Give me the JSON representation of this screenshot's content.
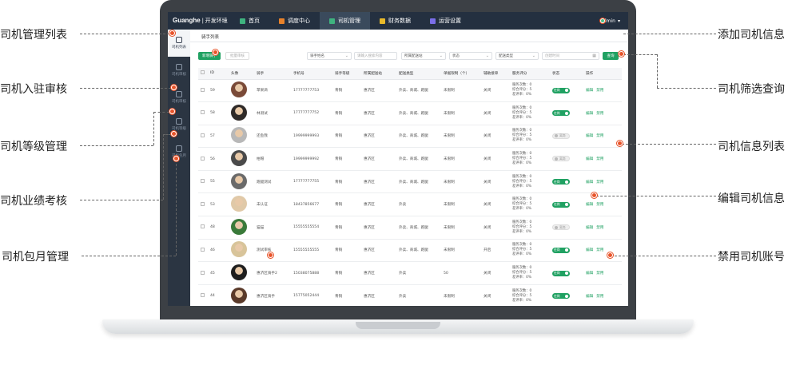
{
  "app": {
    "logo": "Guanghe",
    "logo_sub": "| 开发环境",
    "nav": [
      {
        "label": "首页",
        "icon": "home-icon",
        "color": "#3fb37f"
      },
      {
        "label": "调度中心",
        "icon": "dispatch-icon",
        "color": "#e8822a"
      },
      {
        "label": "司机管理",
        "icon": "driver-icon",
        "color": "#3fb37f"
      },
      {
        "label": "财务数据",
        "icon": "finance-icon",
        "color": "#e8b92a"
      },
      {
        "label": "运营设置",
        "icon": "settings-icon",
        "color": "#7a6ee8"
      }
    ],
    "admin": "admin"
  },
  "sidebar": [
    {
      "label": "司机列表"
    },
    {
      "label": "司机审核"
    },
    {
      "label": "司机审核"
    },
    {
      "label": "司机等级"
    },
    {
      "label": "司机包月"
    }
  ],
  "breadcrumb": "骑手列表",
  "toolbar": {
    "add": "新增骑手",
    "batch": "批量审核"
  },
  "filters": {
    "name": "骑手姓名",
    "search_placeholder": "请输入搜索内容",
    "station": "所属配送站",
    "status": "状态",
    "type": "配送类型",
    "time": "创建时间",
    "search_button": "查询"
  },
  "table": {
    "headers": [
      "",
      "ID",
      "头像",
      "骑手",
      "手机号",
      "骑手等级",
      "所属配送站",
      "配送类型",
      "单据限制（个）",
      "辅助接单",
      "服务评分",
      "状态",
      "操作"
    ],
    "rows": [
      {
        "id": "59",
        "name": "苹果滴",
        "phone": "17777777753",
        "level": "青铜",
        "station": "惠济区",
        "type": "外卖、商城、跑腿",
        "limit": "未限制",
        "assist": "关闭",
        "status": "on",
        "status_label": "在岗"
      },
      {
        "id": "58",
        "name": "林测试",
        "phone": "17777777752",
        "level": "青铜",
        "station": "惠济区",
        "type": "外卖、商城、跑腿",
        "limit": "未限制",
        "assist": "关闭",
        "status": "on",
        "status_label": "在岗"
      },
      {
        "id": "57",
        "name": "还鱼我",
        "phone": "19999999993",
        "level": "青铜",
        "station": "惠济区",
        "type": "外卖、商城、跑腿",
        "limit": "未限制",
        "assist": "关闭",
        "status": "off",
        "status_label": "离岗"
      },
      {
        "id": "56",
        "name": "柏帽",
        "phone": "19999999992",
        "level": "青铜",
        "station": "惠济区",
        "type": "外卖、商城、跑腿",
        "limit": "未限制",
        "assist": "关闭",
        "status": "off",
        "status_label": "离岗"
      },
      {
        "id": "55",
        "name": "跑腿测试",
        "phone": "17777777755",
        "level": "青铜",
        "station": "惠济区",
        "type": "外卖、商城、跑腿",
        "limit": "未限制",
        "assist": "关闭",
        "status": "on",
        "status_label": "在岗"
      },
      {
        "id": "53",
        "name": "未认证",
        "phone": "18437856677",
        "level": "青铜",
        "station": "惠济区",
        "type": "外卖",
        "limit": "未限制",
        "assist": "关闭",
        "status": "on",
        "status_label": "在岗"
      },
      {
        "id": "48",
        "name": "猫猫",
        "phone": "15555555554",
        "level": "青铜",
        "station": "惠济区",
        "type": "外卖、商城、跑腿",
        "limit": "未限制",
        "assist": "关闭",
        "status": "off",
        "status_label": "离岗"
      },
      {
        "id": "46",
        "name": "测试审核",
        "phone": "15555555555",
        "level": "青铜",
        "station": "惠济区",
        "type": "外卖、商城、跑腿",
        "limit": "未限制",
        "assist": "开启",
        "status": "on",
        "status_label": "在岗"
      },
      {
        "id": "45",
        "name": "惠济区骑手2",
        "phone": "15038075888",
        "level": "青铜",
        "station": "惠济区",
        "type": "外卖",
        "limit": "50",
        "assist": "关闭",
        "status": "on",
        "status_label": "在岗"
      },
      {
        "id": "44",
        "name": "惠济区骑手",
        "phone": "15775052444",
        "level": "青铜",
        "station": "惠济区",
        "type": "外卖",
        "limit": "未限制",
        "assist": "关闭",
        "status": "on",
        "status_label": "在岗"
      }
    ],
    "rating": [
      "服务次数：0",
      "综合评分：5",
      "差评率：0%"
    ],
    "actions": [
      "编辑",
      "禁用"
    ]
  },
  "callouts": {
    "left": [
      "司机管理列表",
      "司机入驻审核",
      "司机等级管理",
      "司机业绩考核",
      "司机包月管理"
    ],
    "right": [
      "添加司机信息",
      "司机筛选查询",
      "司机信息列表",
      "编辑司机信息",
      "禁用司机账号"
    ]
  },
  "colors": {
    "accent": "#20a162",
    "topbar": "#243040",
    "callout_dot": "#e8542a"
  }
}
